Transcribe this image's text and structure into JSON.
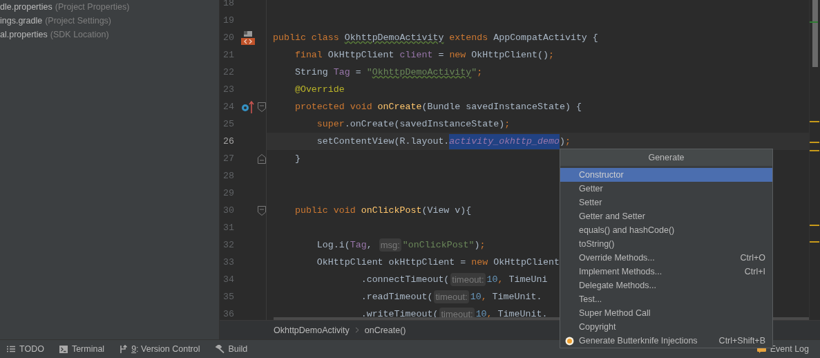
{
  "project_panel": {
    "items": [
      {
        "name": "dle.properties",
        "note": "(Project Properties)"
      },
      {
        "name": "ings.gradle",
        "note": "(Project Settings)"
      },
      {
        "name": "al.properties",
        "note": "(SDK Location)"
      }
    ]
  },
  "editor": {
    "lines": [
      {
        "number": "18",
        "current": false,
        "kind": "code"
      },
      {
        "number": "19",
        "current": false,
        "kind": "code"
      },
      {
        "number": "20",
        "current": false,
        "kind": "class",
        "tokens": [
          {
            "kind": "kw",
            "text": "public class "
          },
          {
            "kind": "typo",
            "text": "OkhttpDemoActivity"
          },
          {
            "kind": "kw",
            "text": " extends "
          },
          {
            "kind": "plain",
            "text": "AppCompatActivity {"
          }
        ]
      },
      {
        "number": "21",
        "current": false,
        "kind": "code",
        "tokens": [
          {
            "kind": "kw",
            "text": "    final "
          },
          {
            "kind": "plain",
            "text": "OkHttpClient "
          },
          {
            "kind": "field",
            "text": "client"
          },
          {
            "kind": "plain",
            "text": " = "
          },
          {
            "kind": "kw",
            "text": "new "
          },
          {
            "kind": "plain",
            "text": "OkHttpClient()"
          },
          {
            "kind": "kw",
            "text": ";"
          }
        ]
      },
      {
        "number": "22",
        "current": false,
        "kind": "code",
        "tokens": [
          {
            "kind": "plain",
            "text": "    String "
          },
          {
            "kind": "field",
            "text": "Tag"
          },
          {
            "kind": "plain",
            "text": " = "
          },
          {
            "kind": "str",
            "text": "\""
          },
          {
            "kind": "strtypo",
            "text": "OkhttpDemoActivity"
          },
          {
            "kind": "str",
            "text": "\""
          },
          {
            "kind": "kw",
            "text": ";"
          }
        ]
      },
      {
        "number": "23",
        "current": false,
        "kind": "code",
        "tokens": [
          {
            "kind": "ann",
            "text": "    @Override"
          }
        ]
      },
      {
        "number": "24",
        "current": false,
        "kind": "override",
        "tokens": [
          {
            "kind": "kw",
            "text": "    protected void "
          },
          {
            "kind": "fn",
            "text": "onCreate"
          },
          {
            "kind": "plain",
            "text": "(Bundle savedInstanceState) {"
          }
        ]
      },
      {
        "number": "25",
        "current": false,
        "kind": "code",
        "tokens": [
          {
            "kind": "kw",
            "text": "        super"
          },
          {
            "kind": "plain",
            "text": ".onCreate(savedInstanceState)"
          },
          {
            "kind": "kw",
            "text": ";"
          }
        ]
      },
      {
        "number": "26",
        "current": true,
        "kind": "code",
        "tokens": [
          {
            "kind": "plain",
            "text": "        setContentView(R.layout."
          },
          {
            "kind": "sel",
            "text": "activity_okhttp_demo"
          },
          {
            "kind": "plain",
            "text": ")"
          },
          {
            "kind": "kw",
            "text": ";"
          }
        ]
      },
      {
        "number": "27",
        "current": false,
        "kind": "fold_end",
        "tokens": [
          {
            "kind": "plain",
            "text": "    }"
          }
        ]
      },
      {
        "number": "28",
        "current": false,
        "kind": "code"
      },
      {
        "number": "29",
        "current": false,
        "kind": "code"
      },
      {
        "number": "30",
        "current": false,
        "kind": "fold_start",
        "tokens": [
          {
            "kind": "kw",
            "text": "    public void "
          },
          {
            "kind": "fn",
            "text": "onClickPost"
          },
          {
            "kind": "plain",
            "text": "(View v){"
          }
        ]
      },
      {
        "number": "31",
        "current": false,
        "kind": "code"
      },
      {
        "number": "32",
        "current": false,
        "kind": "code",
        "tokens": [
          {
            "kind": "plain",
            "text": "        Log.i("
          },
          {
            "kind": "field",
            "text": "Tag"
          },
          {
            "kind": "plain",
            "text": ", "
          },
          {
            "kind": "hint",
            "text": "msg:"
          },
          {
            "kind": "str",
            "text": "\"onClickPost\""
          },
          {
            "kind": "plain",
            "text": ")"
          },
          {
            "kind": "kw",
            "text": ";"
          }
        ]
      },
      {
        "number": "33",
        "current": false,
        "kind": "code",
        "tokens": [
          {
            "kind": "plain",
            "text": "        OkHttpClient okHttpClient = "
          },
          {
            "kind": "kw",
            "text": "new "
          },
          {
            "kind": "plain",
            "text": "OkHttpClient"
          }
        ]
      },
      {
        "number": "34",
        "current": false,
        "kind": "code",
        "tokens": [
          {
            "kind": "plain",
            "text": "                .connectTimeout("
          },
          {
            "kind": "hint",
            "text": "timeout:"
          },
          {
            "kind": "num",
            "text": "10"
          },
          {
            "kind": "kw",
            "text": ", "
          },
          {
            "kind": "plain",
            "text": "TimeUni"
          }
        ]
      },
      {
        "number": "35",
        "current": false,
        "kind": "code",
        "tokens": [
          {
            "kind": "plain",
            "text": "                .readTimeout("
          },
          {
            "kind": "hint",
            "text": "timeout:"
          },
          {
            "kind": "num",
            "text": "10"
          },
          {
            "kind": "kw",
            "text": ", "
          },
          {
            "kind": "plain",
            "text": "TimeUnit."
          }
        ]
      },
      {
        "number": "36",
        "current": false,
        "kind": "code",
        "tokens": [
          {
            "kind": "plain",
            "text": "                .writeTimeout("
          },
          {
            "kind": "hint",
            "text": "timeout:"
          },
          {
            "kind": "num",
            "text": "10"
          },
          {
            "kind": "kw",
            "text": ", "
          },
          {
            "kind": "plain",
            "text": "TimeUnit."
          }
        ]
      }
    ]
  },
  "breadcrumbs": [
    "OkhttpDemoActivity",
    "onCreate()"
  ],
  "generate_popup": {
    "title": "Generate",
    "items": [
      {
        "kind": "action",
        "label": "Constructor",
        "selected": true
      },
      {
        "kind": "action",
        "label": "Getter",
        "selected": false
      },
      {
        "kind": "action",
        "label": "Setter",
        "selected": false
      },
      {
        "kind": "action",
        "label": "Getter and Setter",
        "selected": false
      },
      {
        "kind": "action",
        "label": "equals() and hashCode()",
        "selected": false
      },
      {
        "kind": "action",
        "label": "toString()",
        "selected": false
      },
      {
        "kind": "action",
        "label": "Override Methods...",
        "shortcut": "Ctrl+O",
        "selected": false
      },
      {
        "kind": "action",
        "label": "Implement Methods...",
        "shortcut": "Ctrl+I",
        "selected": false
      },
      {
        "kind": "action",
        "label": "Delegate Methods...",
        "selected": false
      },
      {
        "kind": "action",
        "label": "Test...",
        "selected": false
      },
      {
        "kind": "action",
        "label": "Super Method Call",
        "selected": false
      },
      {
        "kind": "action",
        "label": "Copyright",
        "selected": false
      },
      {
        "kind": "plugin",
        "label": "Generate Butterknife Injections",
        "shortcut": "Ctrl+Shift+B",
        "selected": false
      }
    ]
  },
  "tool_windows": [
    {
      "kind": "todo",
      "label": "TODO"
    },
    {
      "kind": "terminal",
      "label": "Terminal"
    },
    {
      "kind": "vcs",
      "mnemonic": "9",
      "label": ": Version Control"
    },
    {
      "kind": "build",
      "label": "Build"
    }
  ],
  "event_log": {
    "label": "Event Log"
  }
}
